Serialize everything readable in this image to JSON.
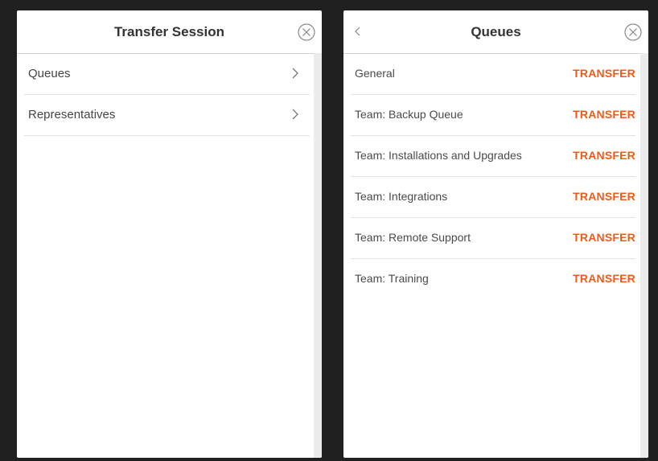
{
  "left_panel": {
    "title": "Transfer Session",
    "items": [
      {
        "label": "Queues"
      },
      {
        "label": "Representatives"
      }
    ]
  },
  "right_panel": {
    "title": "Queues",
    "action_label": "TRANSFER",
    "items": [
      {
        "label": "General"
      },
      {
        "label": "Team: Backup Queue"
      },
      {
        "label": "Team: Installations and Upgrades"
      },
      {
        "label": "Team: Integrations"
      },
      {
        "label": "Team: Remote Support"
      },
      {
        "label": "Team: Training"
      }
    ]
  },
  "icons": {
    "close": "close-circle-icon",
    "back": "chevron-left-icon",
    "nav": "chevron-right-icon"
  },
  "colors": {
    "accent": "#ef5b17",
    "background": "#202020",
    "panel": "#ffffff"
  }
}
